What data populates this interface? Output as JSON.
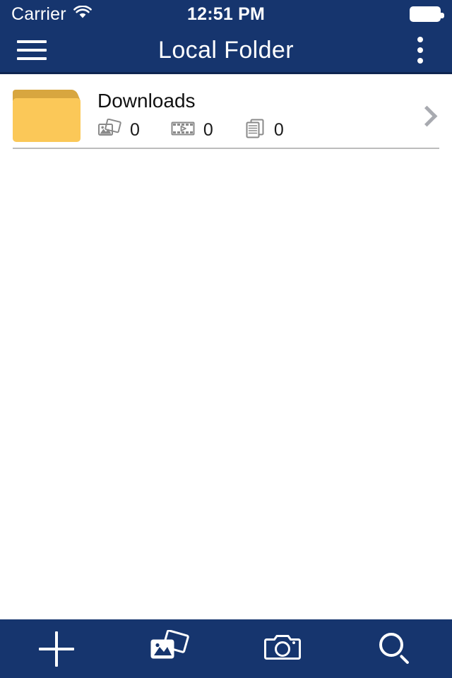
{
  "status_bar": {
    "carrier": "Carrier",
    "wifi_icon": "wifi-icon",
    "time": "12:51 PM",
    "battery_icon": "battery-full-icon"
  },
  "nav_bar": {
    "menu_icon": "hamburger-menu-icon",
    "title": "Local Folder",
    "overflow_icon": "more-vertical-icon"
  },
  "colors": {
    "navy": "#16356E",
    "navy_dark": "#0F2550",
    "folder_body": "#FBC858",
    "folder_tab": "#D8A63F",
    "divider": "#BCBCBC",
    "chevron": "#A8AAB0",
    "content_bg": "#FFFFFF"
  },
  "list": {
    "items": [
      {
        "icon": "folder-icon",
        "name": "Downloads",
        "counts": [
          {
            "icon": "photos-icon",
            "value": "0"
          },
          {
            "icon": "video-icon",
            "value": "0"
          },
          {
            "icon": "documents-icon",
            "value": "0"
          }
        ],
        "accessory": "chevron-right-icon"
      }
    ]
  },
  "toolbar": {
    "buttons": [
      {
        "icon": "plus-icon",
        "label": "Add"
      },
      {
        "icon": "photo-library-icon",
        "label": "Photos"
      },
      {
        "icon": "camera-icon",
        "label": "Camera"
      },
      {
        "icon": "search-icon",
        "label": "Search"
      }
    ]
  }
}
